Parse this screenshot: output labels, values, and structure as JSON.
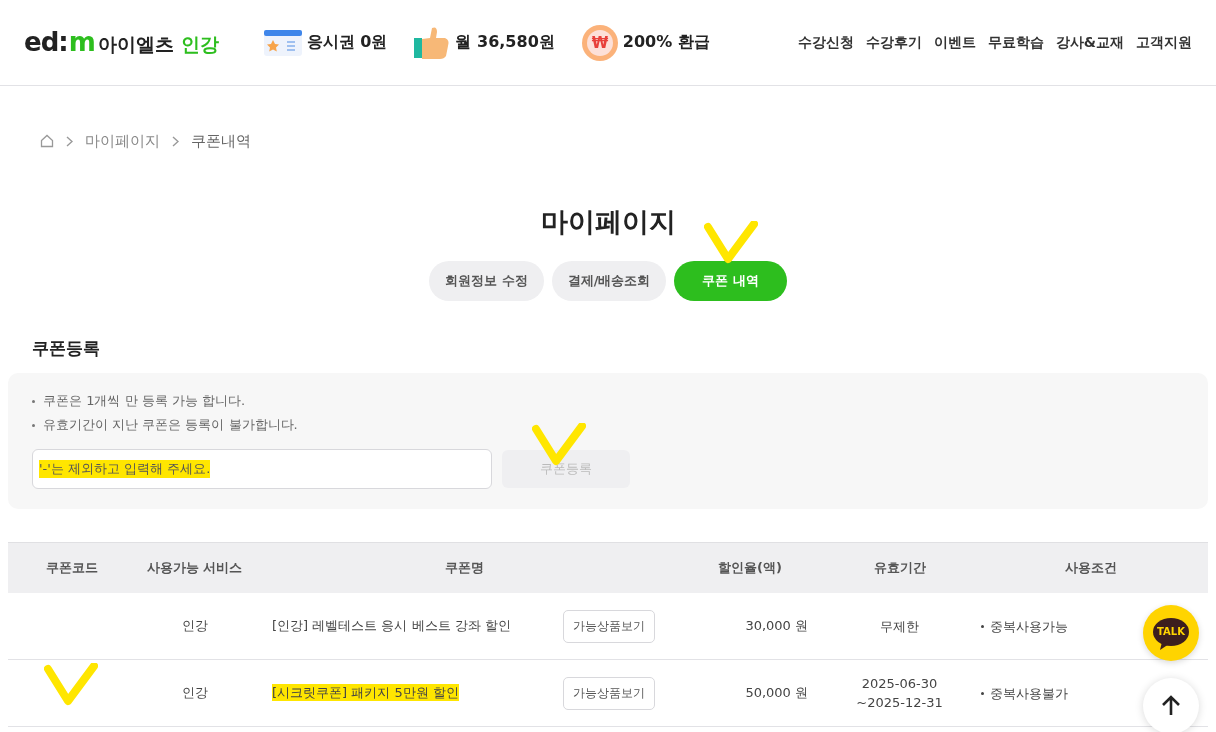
{
  "header": {
    "logo": {
      "mark_dark": "ed:",
      "mark_green": "m",
      "name": "아이엘츠",
      "sub": "인강"
    },
    "promos": [
      {
        "kind": "ticket",
        "text": "응시권 0원"
      },
      {
        "kind": "thumb",
        "text": "월 36,580원"
      },
      {
        "kind": "coin",
        "icon_char": "₩",
        "text": "200% 환급"
      }
    ],
    "nav": [
      "수강신청",
      "수강후기",
      "이벤트",
      "무료학습",
      "강사&교재",
      "고객지원"
    ]
  },
  "breadcrumb": [
    "마이페이지",
    "쿠폰내역"
  ],
  "page_title": "마이페이지",
  "tabs": [
    {
      "label": "회원정보 수정",
      "selected": false,
      "marked": false
    },
    {
      "label": "결제/배송조회",
      "selected": false,
      "marked": false
    },
    {
      "label": "쿠폰 내역",
      "selected": true,
      "marked": true
    }
  ],
  "coupon_register": {
    "title": "쿠폰등록",
    "notes": [
      "쿠폰은 1개씩 만 등록 가능 합니다.",
      "유효기간이 지난 쿠폰은 등록이 불가합니다."
    ],
    "field": {
      "placeholder": "'-'는 제외하고 입력해 주세요.",
      "highlighted": true
    },
    "button": {
      "label": "쿠폰등록",
      "disabled": true,
      "marked": true
    }
  },
  "table": {
    "columns": [
      "쿠폰코드",
      "사용가능 서비스",
      "쿠폰명",
      "할인율(액)",
      "유효기간",
      "사용조건"
    ],
    "rows": [
      {
        "marked": false,
        "service": "인강",
        "name": "[인강] 레벨테스트 응시 베스트 강좌 할인",
        "highlighted": false,
        "action": "가능상품보기",
        "discount": "30,000 원",
        "period": [
          "무제한"
        ],
        "condition": "중복사용가능"
      },
      {
        "marked": true,
        "service": "인강",
        "name": "[시크릿쿠폰] 패키지 5만원 할인",
        "highlighted": true,
        "action": "가능상품보기",
        "discount": "50,000 원",
        "period": [
          "2025-06-30",
          "~2025-12-31"
        ],
        "condition": "중복사용불가"
      }
    ]
  },
  "floating": {
    "chat_label": "TALK"
  }
}
